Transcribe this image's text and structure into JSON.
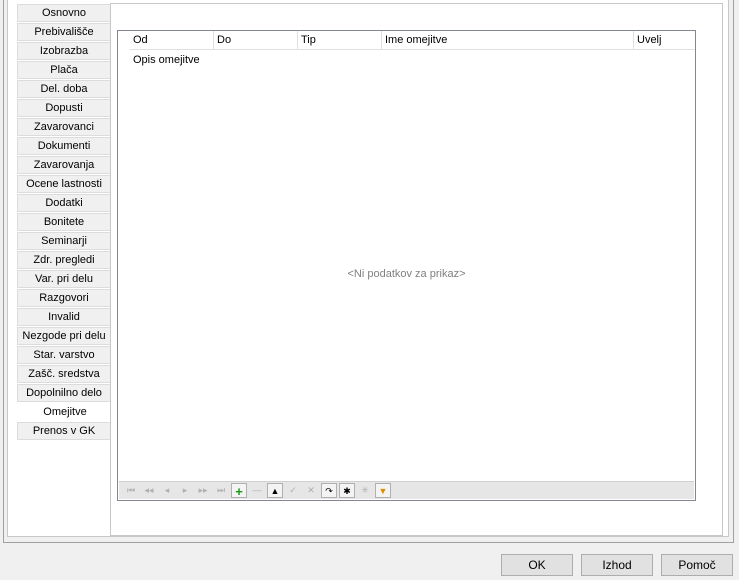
{
  "tabs": [
    "Osnovno",
    "Prebivališče",
    "Izobrazba",
    "Plača",
    "Del. doba",
    "Dopusti",
    "Zavarovanci",
    "Dokumenti",
    "Zavarovanja",
    "Ocene lastnosti",
    "Dodatki",
    "Bonitete",
    "Seminarji",
    "Zdr. pregledi",
    "Var. pri delu",
    "Razgovori",
    "Invalid",
    "Nezgode pri delu",
    "Star. varstvo",
    "Zašč. sredstva",
    "Dopolnilno delo",
    "Omejitve",
    "Prenos v GK"
  ],
  "active_tab": "Omejitve",
  "grid": {
    "columns": [
      "Od",
      "Do",
      "Tip",
      "Ime omejitve",
      "Uvelj"
    ],
    "subcolumn": "Opis omejitve",
    "empty_text": "<Ni podatkov za prikaz>"
  },
  "navigator": {
    "buttons": [
      {
        "name": "first-page-icon",
        "glyph": "⏮",
        "enabled": false
      },
      {
        "name": "previous-page-icon",
        "glyph": "◂◂",
        "enabled": false
      },
      {
        "name": "previous-record-icon",
        "glyph": "◂",
        "enabled": false
      },
      {
        "name": "next-record-icon",
        "glyph": "▸",
        "enabled": false
      },
      {
        "name": "next-page-icon",
        "glyph": "▸▸",
        "enabled": false
      },
      {
        "name": "last-page-icon",
        "glyph": "⏭",
        "enabled": false
      },
      {
        "name": "append-record-icon",
        "glyph": "+",
        "enabled": true
      },
      {
        "name": "delete-record-icon",
        "glyph": "—",
        "enabled": false
      },
      {
        "name": "edit-record-icon",
        "glyph": "▲",
        "enabled": true
      },
      {
        "name": "post-edit-icon",
        "glyph": "✓",
        "enabled": false
      },
      {
        "name": "cancel-edit-icon",
        "glyph": "✕",
        "enabled": false
      },
      {
        "name": "refresh-icon",
        "glyph": "↷",
        "enabled": true
      },
      {
        "name": "bookmark-icon",
        "glyph": "✱",
        "enabled": true
      },
      {
        "name": "goto-bookmark-icon",
        "glyph": "✳",
        "enabled": false
      },
      {
        "name": "filter-icon",
        "glyph": "▼",
        "enabled": true
      }
    ]
  },
  "buttons": {
    "ok": "OK",
    "exit": "Izhod",
    "help": "Pomoč"
  }
}
